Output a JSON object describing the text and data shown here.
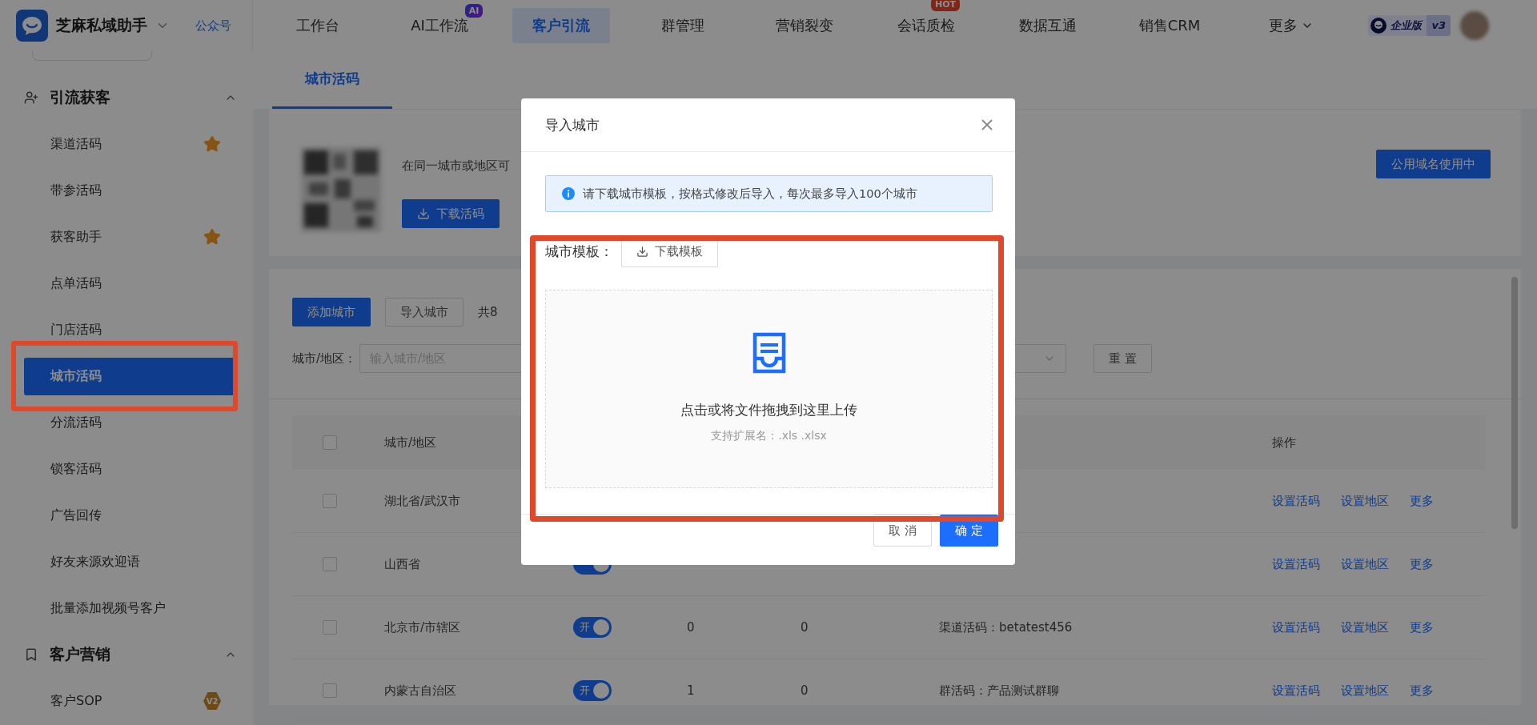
{
  "app": {
    "name": "芝麻私域助手",
    "link": "公众号"
  },
  "nav": [
    {
      "label": "工作台",
      "selected": false
    },
    {
      "label": "AI工作流",
      "selected": false,
      "badge": "AI",
      "kind": "ai"
    },
    {
      "label": "客户引流",
      "selected": true
    },
    {
      "label": "群管理",
      "selected": false
    },
    {
      "label": "营销裂变",
      "selected": false
    },
    {
      "label": "会话质检",
      "selected": false,
      "badge": "HOT",
      "kind": "hot"
    },
    {
      "label": "数据互通",
      "selected": false
    },
    {
      "label": "销售CRM",
      "selected": false
    },
    {
      "label": "更多",
      "selected": false,
      "dropdown": true
    }
  ],
  "edition": {
    "label": "企业版",
    "version": "v3"
  },
  "sidebar": {
    "groups": [
      {
        "title": "引流获客",
        "kind": "user",
        "expanded": true,
        "items": [
          {
            "label": "渠道活码",
            "selected": false,
            "starred": true
          },
          {
            "label": "带参活码",
            "selected": false,
            "starred": false
          },
          {
            "label": "获客助手",
            "selected": false,
            "starred": true
          },
          {
            "label": "点单活码",
            "selected": false,
            "starred": false
          },
          {
            "label": "门店活码",
            "selected": false,
            "starred": false
          },
          {
            "label": "城市活码",
            "selected": true,
            "starred": false
          },
          {
            "label": "分流活码",
            "selected": false,
            "starred": false
          },
          {
            "label": "锁客活码",
            "selected": false,
            "starred": false
          },
          {
            "label": "广告回传",
            "selected": false,
            "starred": false
          },
          {
            "label": "好友来源欢迎语",
            "selected": false,
            "starred": false
          },
          {
            "label": "批量添加视频号客户",
            "selected": false,
            "starred": false
          }
        ]
      },
      {
        "title": "客户营销",
        "kind": "bookmark",
        "expanded": true,
        "items": [
          {
            "label": "客户SOP",
            "selected": false,
            "starred": false,
            "badge": "V2"
          }
        ]
      }
    ]
  },
  "page_tabs": [
    {
      "label": "城市活码",
      "selected": true
    }
  ],
  "intro": {
    "text": "在同一城市或地区可",
    "download_button": "下载活码",
    "domain_button": "公用域名使用中"
  },
  "toolbar": {
    "buttons": [
      {
        "label": "添加城市",
        "kind": "primary"
      },
      {
        "label": "导入城市",
        "kind": "default"
      }
    ],
    "total": "共8"
  },
  "filter": {
    "label": "城市/地区：",
    "placeholder": "输入城市/地区",
    "reset": "重 置"
  },
  "table": {
    "columns": {
      "city": "城市/地区",
      "actions": "操作"
    },
    "header_checked": false,
    "rows": [
      {
        "checked": false,
        "city": "湖北省/武汉市",
        "actions": [
          "设置活码",
          "设置地区",
          "更多"
        ]
      },
      {
        "checked": false,
        "city": "山西省",
        "on": true,
        "actions": [
          "设置活码",
          "设置地区",
          "更多"
        ]
      },
      {
        "checked": false,
        "city": "北京市/市辖区",
        "on": true,
        "toggle_label": "开",
        "clicks": "0",
        "adds": "0",
        "code": "渠道活码：betatest456",
        "actions": [
          "设置活码",
          "设置地区",
          "更多"
        ]
      },
      {
        "checked": false,
        "city": "内蒙古自治区",
        "on": true,
        "toggle_label": "开",
        "clicks": "1",
        "adds": "0",
        "code": "群活码：产品测试群聊",
        "actions": [
          "设置活码",
          "设置地区",
          "更多"
        ]
      }
    ]
  },
  "dialog": {
    "title": "导入城市",
    "notice": "请下载城市模板，按格式修改后导入，每次最多导入100个城市",
    "template_label": "城市模板：",
    "template_button": "下载模板",
    "upload_text": "点击或将文件拖拽到这里上传",
    "upload_hint": "支持扩展名：.xls .xlsx",
    "cancel": "取 消",
    "confirm": "确 定"
  }
}
